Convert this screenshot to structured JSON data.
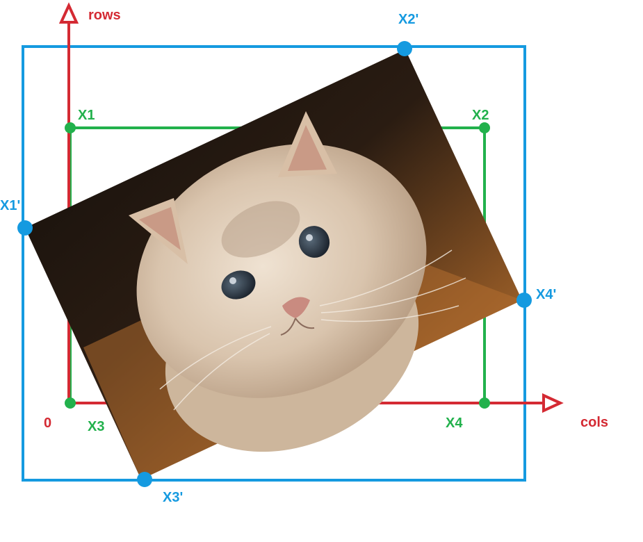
{
  "colors": {
    "axis": "#d42a33",
    "original": "#22b14c",
    "rotated": "#159ae0",
    "photo_dark": "#1a1410",
    "photo_warm": "#c8833a",
    "fur_light": "#e6d6c4",
    "fur_mid": "#c9b39b",
    "eye": "#2f3b48",
    "nose": "#c98b80"
  },
  "axes": {
    "origin_label": "0",
    "rows_label": "rows",
    "cols_label": "cols"
  },
  "original_corners": {
    "x1": "X1",
    "x2": "X2",
    "x3": "X3",
    "x4": "X4"
  },
  "rotated_corners": {
    "x1": "X1'",
    "x2": "X2'",
    "x3": "X3'",
    "x4": "X4'"
  },
  "photo": {
    "subject": "cat-photo"
  }
}
